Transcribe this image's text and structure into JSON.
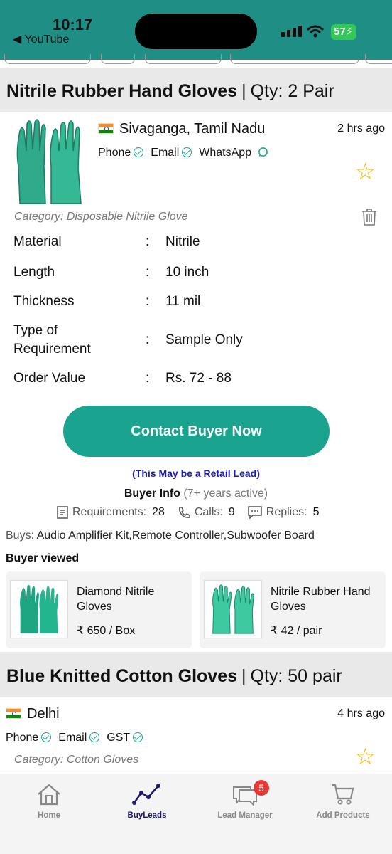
{
  "status_bar": {
    "time": "10:17",
    "back_app": "◀ YouTube",
    "battery": "57"
  },
  "lead1": {
    "title": "Nitrile Rubber Hand Gloves",
    "qty": "Qty: 2 Pair",
    "location": "Sivaganga, Tamil Nadu",
    "time_ago": "2 hrs ago",
    "contacts": [
      "Phone",
      "Email",
      "WhatsApp"
    ],
    "category": "Category: Disposable Nitrile Glove",
    "specs": [
      {
        "key": "Material",
        "value": "Nitrile"
      },
      {
        "key": "Length",
        "value": "10 inch"
      },
      {
        "key": "Thickness",
        "value": "11 mil"
      },
      {
        "key": "Type of Requirement",
        "value": "Sample Only"
      },
      {
        "key": "Order Value",
        "value": "Rs. 72 - 88"
      }
    ],
    "cta": "Contact Buyer Now",
    "retail_note": "(This May be a Retail Lead)",
    "buyer_info_label": "Buyer Info",
    "buyer_active": "(7+ years active)",
    "stats": {
      "requirements_label": "Requirements:",
      "requirements": "28",
      "calls_label": "Calls:",
      "calls": "9",
      "replies_label": "Replies:",
      "replies": "5"
    },
    "buys_label": "Buys:",
    "buys": "Audio Amplifier Kit,Remote Controller,Subwoofer Board",
    "viewed_title": "Buyer viewed",
    "viewed": [
      {
        "name": "Diamond Nitrile Gloves",
        "price": "₹ 650 / Box"
      },
      {
        "name": "Nitrile Rubber Hand Gloves",
        "price": "₹ 42 / pair"
      }
    ]
  },
  "lead2": {
    "title": "Blue Knitted Cotton Gloves",
    "qty": "Qty: 50 pair",
    "location": "Delhi",
    "time_ago": "4 hrs ago",
    "contacts": [
      "Phone",
      "Email",
      "GST"
    ],
    "category": "Category: Cotton Gloves"
  },
  "nav": {
    "items": [
      "Home",
      "BuyLeads",
      "Lead Manager",
      "Add Products"
    ],
    "active": "BuyLeads",
    "lead_manager_badge": "5"
  },
  "colors": {
    "accent": "#1aa38f",
    "header": "#1f8f86",
    "active_nav": "#1e1a6b",
    "star": "#f2b705"
  }
}
